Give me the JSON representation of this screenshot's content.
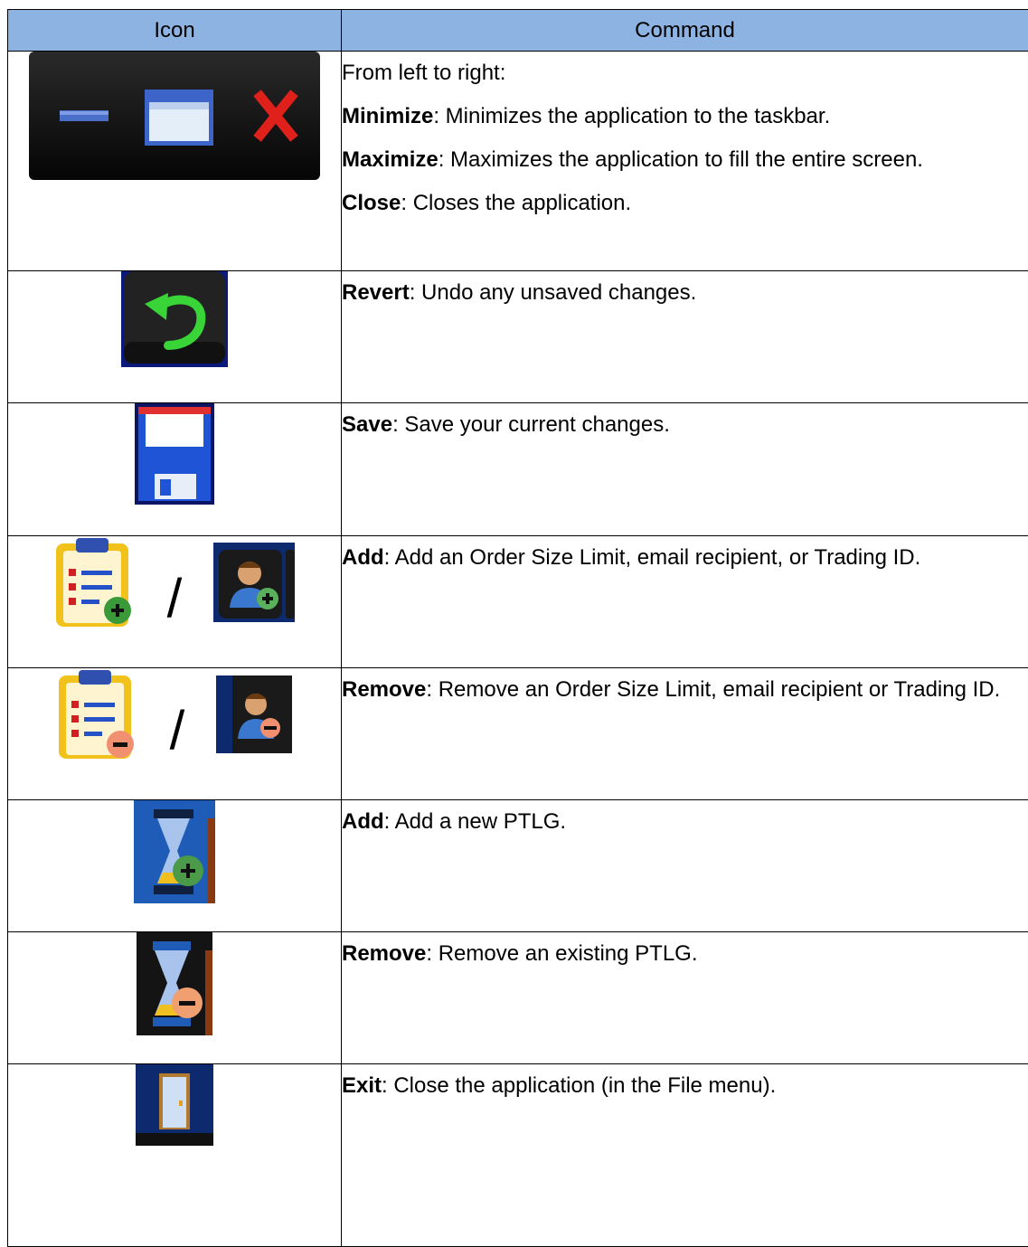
{
  "header": {
    "icon_col": "Icon",
    "command_col": "Command"
  },
  "rows": [
    {
      "icons": [
        "minimize-icon",
        "maximize-icon",
        "close-icon"
      ],
      "intro": "From left to right:",
      "entries": [
        {
          "term": "Minimize",
          "desc": ": Minimizes the application to the taskbar."
        },
        {
          "term": "Maximize",
          "desc": ": Maximizes the application to fill the entire screen."
        },
        {
          "term": "Close",
          "desc": ": Closes the application."
        }
      ]
    },
    {
      "icons": [
        "revert-icon"
      ],
      "entries": [
        {
          "term": "Revert",
          "desc": ": Undo any unsaved changes."
        }
      ]
    },
    {
      "icons": [
        "save-icon"
      ],
      "entries": [
        {
          "term": "Save",
          "desc": ": Save your current changes."
        }
      ]
    },
    {
      "icons": [
        "add-limit-icon",
        "add-user-icon"
      ],
      "separator": "/",
      "entries": [
        {
          "term": "Add",
          "desc": ": Add an Order Size Limit, email recipient, or Trading ID."
        }
      ]
    },
    {
      "icons": [
        "remove-limit-icon",
        "remove-user-icon"
      ],
      "separator": "/",
      "entries": [
        {
          "term": "Remove",
          "desc": ": Remove an Order Size Limit, email recipient or Trading ID."
        }
      ]
    },
    {
      "icons": [
        "add-ptlg-icon"
      ],
      "entries": [
        {
          "term": "Add",
          "desc": ": Add a new PTLG."
        }
      ]
    },
    {
      "icons": [
        "remove-ptlg-icon"
      ],
      "entries": [
        {
          "term": "Remove",
          "desc": ": Remove an existing PTLG."
        }
      ]
    },
    {
      "icons": [
        "exit-icon"
      ],
      "entries": [
        {
          "term": "Exit",
          "desc": ": Close the application (in the File menu)."
        }
      ]
    }
  ],
  "colors": {
    "header_bg": "#8DB3E2",
    "border": "#000000"
  }
}
